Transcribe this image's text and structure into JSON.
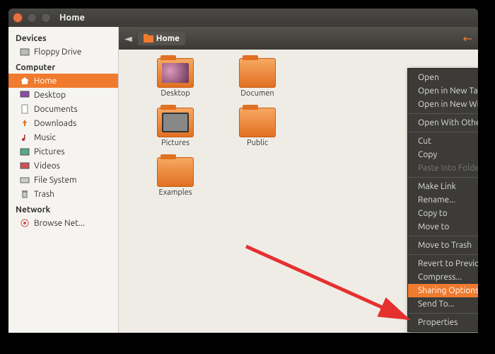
{
  "window": {
    "title": "Home"
  },
  "sidebar": {
    "groups": [
      {
        "label": "Devices",
        "items": [
          {
            "label": "Floppy Drive",
            "icon": "drive-icon"
          }
        ]
      },
      {
        "label": "Computer",
        "items": [
          {
            "label": "Home",
            "icon": "home-icon",
            "selected": true
          },
          {
            "label": "Desktop",
            "icon": "desktop-icon"
          },
          {
            "label": "Documents",
            "icon": "documents-icon"
          },
          {
            "label": "Downloads",
            "icon": "downloads-icon"
          },
          {
            "label": "Music",
            "icon": "music-icon"
          },
          {
            "label": "Pictures",
            "icon": "pictures-icon"
          },
          {
            "label": "Videos",
            "icon": "videos-icon"
          },
          {
            "label": "File System",
            "icon": "filesystem-icon"
          },
          {
            "label": "Trash",
            "icon": "trash-icon"
          }
        ]
      },
      {
        "label": "Network",
        "items": [
          {
            "label": "Browse Net...",
            "icon": "network-icon"
          }
        ]
      }
    ]
  },
  "pathbar": {
    "crumb": "Home"
  },
  "folders": {
    "row1": [
      {
        "label": "Desktop",
        "thumb": "pic"
      },
      {
        "label": "Documen",
        "thumb": ""
      },
      {
        "label": "",
        "thumb": ""
      }
    ],
    "row2": [
      {
        "label": "Pictures",
        "thumb": "frame"
      },
      {
        "label": "Public",
        "thumb": ""
      },
      {
        "label": "",
        "thumb": ""
      }
    ],
    "row3": [
      {
        "label": "Examples",
        "thumb": ""
      }
    ]
  },
  "context_menu": [
    {
      "label": "Open"
    },
    {
      "label": "Open in New Tab"
    },
    {
      "label": "Open in New Window"
    },
    {
      "sep": true
    },
    {
      "label": "Open With Other Application..."
    },
    {
      "sep": true
    },
    {
      "label": "Cut"
    },
    {
      "label": "Copy"
    },
    {
      "label": "Paste Into Folder",
      "disabled": true
    },
    {
      "sep": true
    },
    {
      "label": "Make Link"
    },
    {
      "label": "Rename..."
    },
    {
      "label": "Copy to",
      "submenu": true
    },
    {
      "label": "Move to",
      "submenu": true
    },
    {
      "sep": true
    },
    {
      "label": "Move to Trash"
    },
    {
      "sep": true
    },
    {
      "label": "Revert to Previous Version..."
    },
    {
      "label": "Compress..."
    },
    {
      "label": "Sharing Options",
      "highlight": true
    },
    {
      "label": "Send To..."
    },
    {
      "sep": true
    },
    {
      "label": "Properties"
    }
  ]
}
